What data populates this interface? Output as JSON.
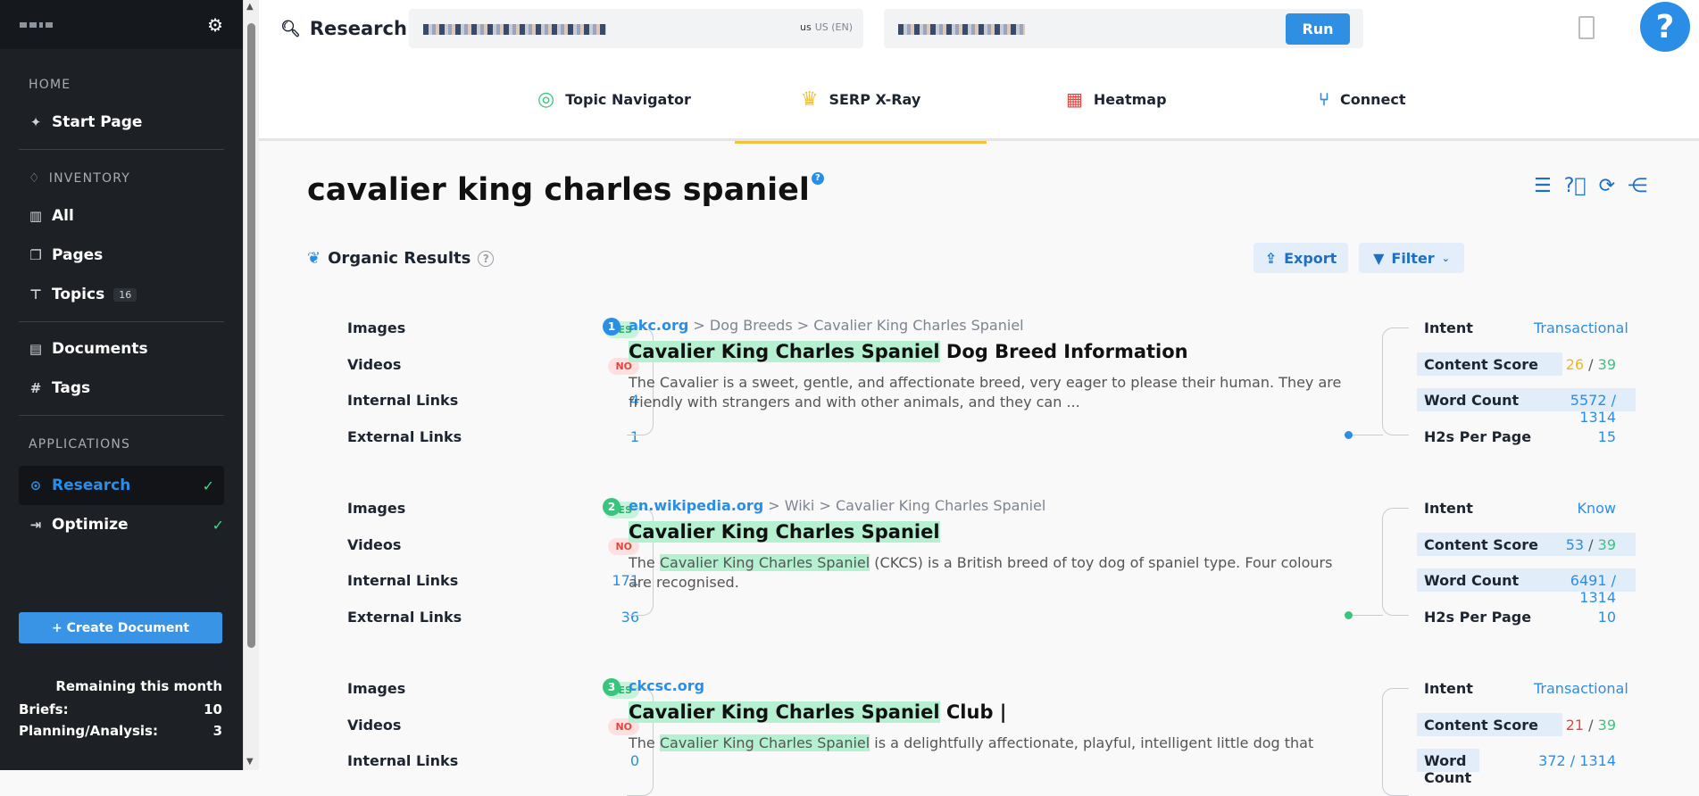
{
  "sidebar": {
    "sections": {
      "home": "HOME",
      "inventory": "INVENTORY",
      "applications": "APPLICATIONS"
    },
    "items": {
      "start_page": "Start Page",
      "all": "All",
      "pages": "Pages",
      "topics": "Topics",
      "topics_count": "16",
      "documents": "Documents",
      "tags": "Tags",
      "research": "Research",
      "optimize": "Optimize"
    },
    "create_button": "+ Create Document",
    "remaining": {
      "title": "Remaining this month",
      "briefs_label": "Briefs:",
      "briefs_value": "10",
      "planning_label": "Planning/Analysis:",
      "planning_value": "3"
    }
  },
  "topbar": {
    "title": "Research",
    "locale": "US (EN)",
    "locale_flag": "us",
    "run_label": "Run",
    "help_label": "?"
  },
  "tabs": [
    {
      "label": "Topic Navigator"
    },
    {
      "label": "SERP X-Ray"
    },
    {
      "label": "Heatmap"
    },
    {
      "label": "Connect"
    }
  ],
  "page": {
    "title": "cavalier king charles spaniel",
    "section": "Organic Results",
    "export_label": "Export",
    "filter_label": "Filter"
  },
  "metrics_labels": {
    "images": "Images",
    "videos": "Videos",
    "internal": "Internal Links",
    "external": "External Links",
    "intent": "Intent",
    "content_score": "Content Score",
    "word_count": "Word Count",
    "h2s": "H2s Per Page"
  },
  "results": [
    {
      "rank": "1",
      "images": "YES",
      "videos": "NO",
      "internal": "4",
      "external": "1",
      "domain": "akc.org",
      "path": " > Dog Breeds > Cavalier King Charles Spaniel",
      "title_hl": "Cavalier King Charles Spaniel",
      "title_rest": " Dog Breed Information",
      "desc_pre": "The Cavalier is a sweet, gentle, and affectionate breed, very eager to please their human. They are friendly with strangers and with other animals, and they can ...",
      "desc_hl": "",
      "desc_post": "",
      "intent": "Transactional",
      "score": "26",
      "score_max": "39",
      "words": "5572 / 1314",
      "h2s": "15",
      "colors": {
        "rank": "#2b8ee6",
        "score": "#f2b422",
        "dot": "#2b8ee6"
      }
    },
    {
      "rank": "2",
      "images": "YES",
      "videos": "NO",
      "internal": "171",
      "external": "36",
      "domain": "en.wikipedia.org",
      "path": " > Wiki > Cavalier King Charles Spaniel",
      "title_hl": "Cavalier King Charles Spaniel",
      "title_rest": "",
      "desc_pre": "The ",
      "desc_hl": "Cavalier King Charles Spaniel",
      "desc_post": " (CKCS) is a British breed of toy dog of spaniel type. Four colours are recognised.",
      "intent": "Know",
      "score": "53",
      "score_max": "39",
      "words": "6491 / 1314",
      "h2s": "10",
      "colors": {
        "rank": "#3ac57e",
        "score": "#2b8ee6",
        "dot": "#3ac57e"
      }
    },
    {
      "rank": "3",
      "images": "YES",
      "videos": "NO",
      "internal": "0",
      "external": "",
      "domain": "ckcsc.org",
      "path": "",
      "title_hl": "Cavalier King Charles Spaniel",
      "title_rest": " Club |",
      "desc_pre": "The ",
      "desc_hl": "Cavalier King Charles Spaniel",
      "desc_post": " is a delightfully affectionate, playful, intelligent little dog that repays his",
      "intent": "Transactional",
      "score": "21",
      "score_max": "39",
      "words": "372 / 1314",
      "h2s": "",
      "colors": {
        "rank": "#3ac57e",
        "score": "#e2473f",
        "dot": "#3ac57e"
      }
    }
  ]
}
